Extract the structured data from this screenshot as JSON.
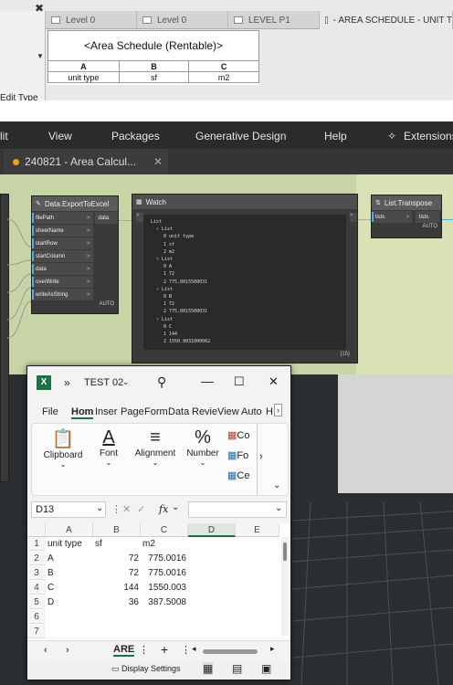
{
  "revit": {
    "edit_type": "Edit Type",
    "close": "✖",
    "tabs": [
      "Level 0",
      "Level 0",
      "LEVEL P1",
      "- AREA SCHEDULE - UNIT T"
    ],
    "schedule": {
      "title": "<Area Schedule (Rentable)>",
      "col_letters": [
        "A",
        "B",
        "C"
      ],
      "col_headers": [
        "unit type",
        "sf",
        "m2"
      ]
    }
  },
  "dynamo": {
    "menu": [
      "lit",
      "View",
      "Packages",
      "Generative Design",
      "Help",
      "Extensions"
    ],
    "tab_title": "240821 - Area Calcul...",
    "tab_close": "✕",
    "export_node": {
      "title": "Data.ExportToExcel",
      "inputs": [
        "filePath",
        "sheetName",
        "startRow",
        "startColumn",
        "data",
        "overWrite",
        "writeAsString"
      ],
      "output": "data",
      "mode": "AUTO"
    },
    "watch_node": {
      "title": "Watch",
      "lines": [
        "List",
        "▿ List",
        "0 unit type",
        "1 sf",
        "2 m2",
        "▿ List",
        "0 A",
        "1 72",
        "2 775.0015500031",
        "▿ List",
        "0 B",
        "1 72",
        "2 775.0015500031",
        "▿ List",
        "0 C",
        "1 144",
        "2 1550.0031000062",
        "▿ List",
        "0 D",
        "1 36",
        "2 387.50077500155"
      ],
      "footer": "{15}"
    },
    "transpose_node": {
      "title": "List.Transpose",
      "input": "lists",
      "output": "lists",
      "mode": "AUTO"
    }
  },
  "excel": {
    "app_badge": "X",
    "title": "TEST 02",
    "chevrons": "»",
    "ribbon_tabs": [
      "File",
      "Hom",
      "Inser",
      "Page",
      "Form",
      "Data",
      "Revie",
      "View",
      "Auto",
      "H"
    ],
    "groups": [
      "Clipboard",
      "Font",
      "Alignment",
      "Number"
    ],
    "style_items": [
      "Co",
      "Fo",
      "Ce"
    ],
    "name_box": "D13",
    "fx": "fx",
    "columns": [
      "A",
      "B",
      "C",
      "D",
      "E"
    ],
    "row_numbers": [
      "1",
      "2",
      "3",
      "4",
      "5",
      "6",
      "7"
    ],
    "rows": [
      [
        "unit type",
        "sf",
        "m2"
      ],
      [
        "A",
        "72",
        "775.0016"
      ],
      [
        "B",
        "72",
        "775.0016"
      ],
      [
        "C",
        "144",
        "1550.003"
      ],
      [
        "D",
        "36",
        "387.5008"
      ]
    ],
    "sheet_tab": "ARE",
    "display_settings": "Display Settings"
  }
}
